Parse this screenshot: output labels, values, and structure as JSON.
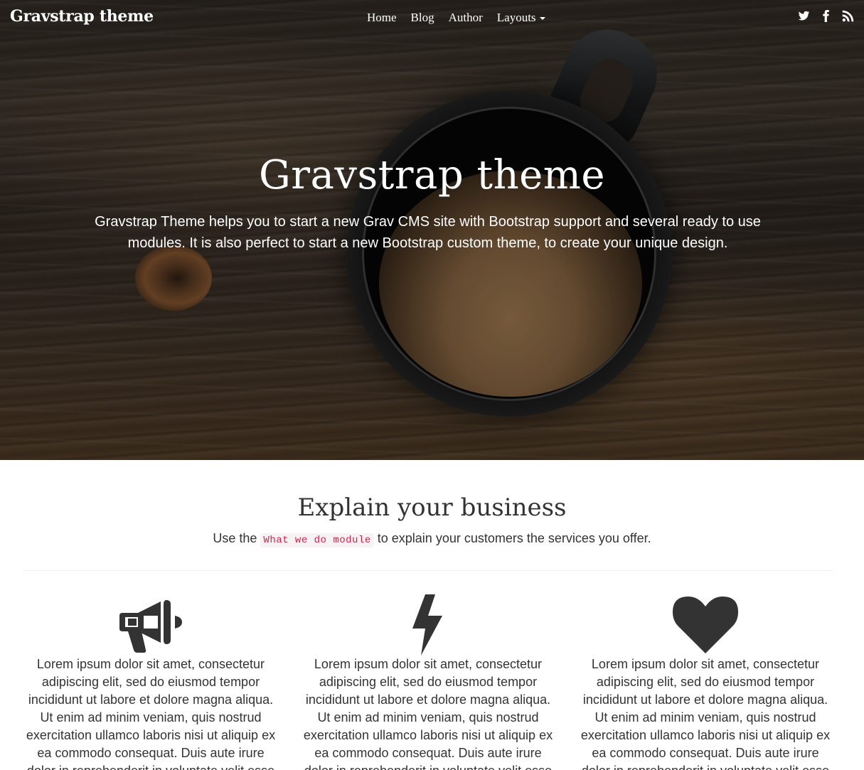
{
  "navbar": {
    "brand": "Gravstrap theme",
    "links": [
      {
        "label": "Home"
      },
      {
        "label": "Blog"
      },
      {
        "label": "Author"
      },
      {
        "label": "Layouts"
      }
    ],
    "social": [
      "twitter-icon",
      "facebook-icon",
      "rss-icon"
    ]
  },
  "hero": {
    "title": "Gravstrap theme",
    "lead": "Gravstrap Theme helps you to start a new Grav CMS site with Bootstrap support and several ready to use modules. It is also perfect to start a new Bootstrap custom theme, to create your unique design."
  },
  "what_we_do": {
    "title": "Explain your business",
    "lead_before": "Use the",
    "lead_code": "What we do module",
    "lead_after": "to explain your customers the services you offer.",
    "features": [
      {
        "icon": "megaphone-icon",
        "text": "Lorem ipsum dolor sit amet, consectetur adipiscing elit, sed do eiusmod tempor incididunt ut labore et dolore magna aliqua. Ut enim ad minim veniam, quis nostrud exercitation ullamco laboris nisi ut aliquip ex ea commodo consequat. Duis aute irure dolor in reprehenderit in voluptate velit esse"
      },
      {
        "icon": "bolt-icon",
        "text": "Lorem ipsum dolor sit amet, consectetur adipiscing elit, sed do eiusmod tempor incididunt ut labore et dolore magna aliqua. Ut enim ad minim veniam, quis nostrud exercitation ullamco laboris nisi ut aliquip ex ea commodo consequat. Duis aute irure dolor in reprehenderit in voluptate velit esse"
      },
      {
        "icon": "heart-icon",
        "text": "Lorem ipsum dolor sit amet, consectetur adipiscing elit, sed do eiusmod tempor incididunt ut labore et dolore magna aliqua. Ut enim ad minim veniam, quis nostrud exercitation ullamco laboris nisi ut aliquip ex ea commodo consequat. Duis aute irure dolor in reprehenderit in voluptate velit esse"
      }
    ]
  },
  "colors": {
    "text": "#333333",
    "code_text": "#c7254e",
    "code_bg": "#f9f2f4",
    "icon": "#333333",
    "nav_text": "#ffffff"
  }
}
